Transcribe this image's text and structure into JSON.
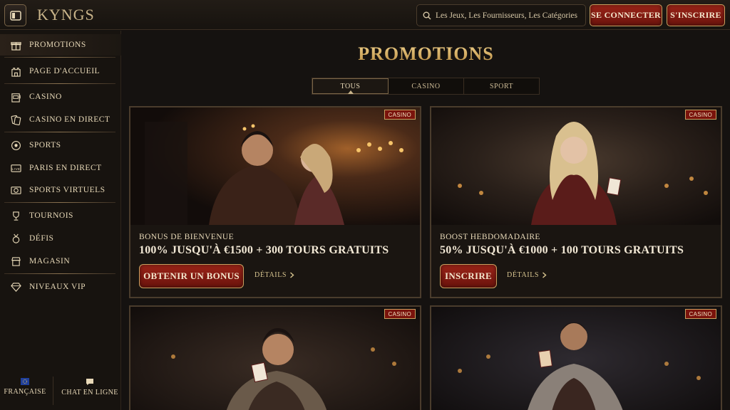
{
  "header": {
    "logo": "KYNGS",
    "search_placeholder": "Les Jeux, Les Fournisseurs, Les Catégories",
    "login_label": "SE CONNECTER",
    "signup_label": "S'INSCRIRE"
  },
  "sidebar": {
    "items": [
      {
        "label": "PROMOTIONS",
        "icon": "gift-icon",
        "active": true
      },
      {
        "label": "PAGE D'ACCUEIL",
        "icon": "castle-icon"
      },
      {
        "label": "CASINO",
        "icon": "slot-machine-icon"
      },
      {
        "label": "CASINO EN DIRECT",
        "icon": "cards-icon"
      },
      {
        "label": "SPORTS",
        "icon": "soccer-ball-icon"
      },
      {
        "label": "PARIS EN DIRECT",
        "icon": "live-icon"
      },
      {
        "label": "SPORTS VIRTUELS",
        "icon": "virtual-sports-icon"
      },
      {
        "label": "TOURNOIS",
        "icon": "trophy-icon"
      },
      {
        "label": "DÉFIS",
        "icon": "medal-icon"
      },
      {
        "label": "MAGASIN",
        "icon": "shop-icon"
      },
      {
        "label": "NIVEAUX VIP",
        "icon": "diamond-icon"
      }
    ],
    "language_label": "FRANÇAISE",
    "chat_label": "CHAT EN LIGNE"
  },
  "main": {
    "title": "PROMOTIONS",
    "tabs": [
      {
        "label": "TOUS",
        "active": true
      },
      {
        "label": "CASINO"
      },
      {
        "label": "SPORT"
      }
    ],
    "cards": [
      {
        "badge": "CASINO",
        "subtitle": "BONUS DE BIENVENUE",
        "title": "100% JUSQU'À €1500 + 300 TOURS GRATUITS",
        "button": "OBTENIR UN BONUS",
        "details": "DÉTAILS"
      },
      {
        "badge": "CASINO",
        "subtitle": "BOOST HEBDOMADAIRE",
        "title": "50% JUSQU'À €1000 + 100 TOURS GRATUITS",
        "button": "INSCRIRE",
        "details": "DÉTAILS"
      },
      {
        "badge": "CASINO"
      },
      {
        "badge": "CASINO"
      }
    ]
  },
  "colors": {
    "background": "#151210",
    "accent_gold": "#d9b36a",
    "button_red": "#8a1c12",
    "badge_red": "#7a130c"
  }
}
